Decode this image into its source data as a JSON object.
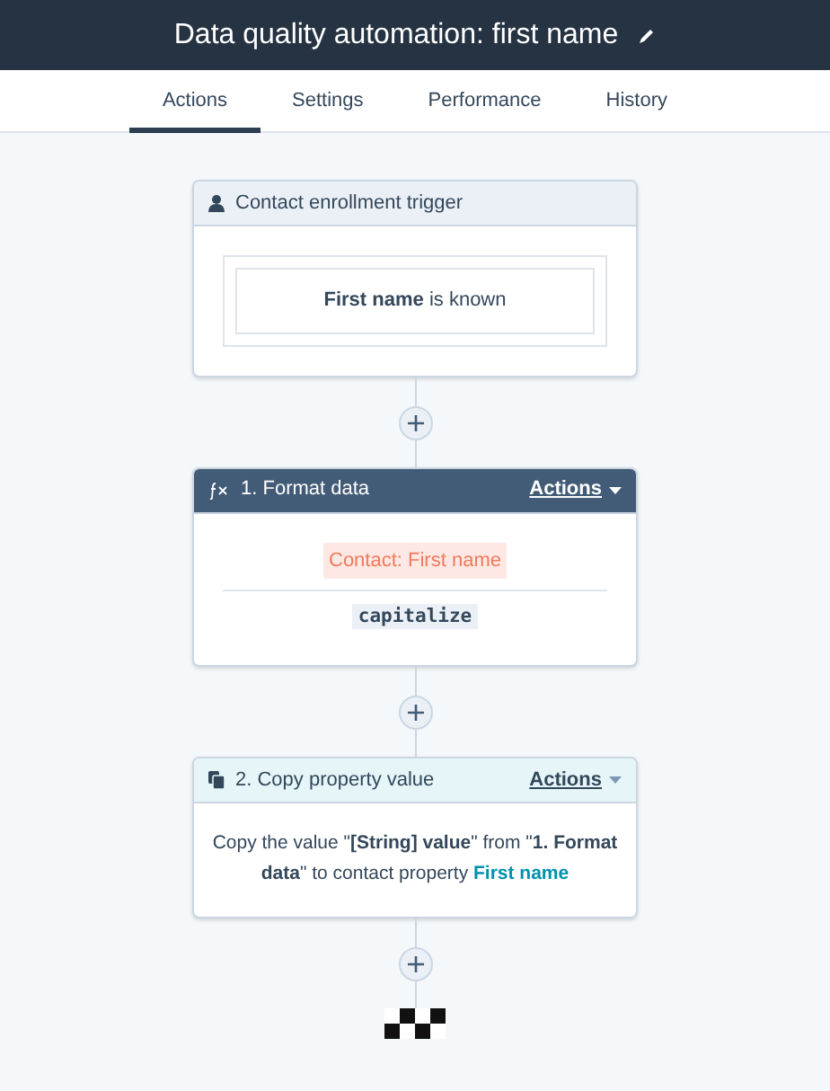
{
  "header": {
    "title": "Data quality automation: first name"
  },
  "tabs": [
    {
      "label": "Actions",
      "selected": true
    },
    {
      "label": "Settings",
      "selected": false
    },
    {
      "label": "Performance",
      "selected": false
    },
    {
      "label": "History",
      "selected": false
    }
  ],
  "steps": [
    {
      "kind": "trigger",
      "title": "Contact enrollment trigger",
      "filter": "**First name** is known"
    },
    {
      "kind": "format",
      "title": "1. Format data",
      "menu": "Actions",
      "property": "Contact: First name",
      "operation": "capitalize"
    },
    {
      "kind": "copy",
      "title": "2. Copy property value",
      "menu": "Actions",
      "sentence": "Copy the value \"**[String] value**\" from \"**1. Format data**\" to contact property",
      "link": "First name"
    }
  ]
}
